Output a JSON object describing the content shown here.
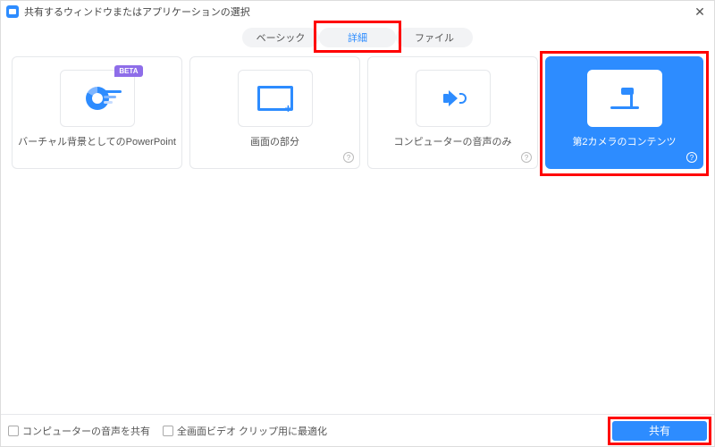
{
  "window": {
    "title": "共有するウィンドウまたはアプリケーションの選択"
  },
  "tabs": {
    "basic": "ベーシック",
    "advanced": "詳細",
    "file": "ファイル"
  },
  "cards": {
    "ppt": {
      "label": "バーチャル背景としてのPowerPoint",
      "badge": "BETA"
    },
    "portion": {
      "label": "画面の部分"
    },
    "audio": {
      "label": "コンピューターの音声のみ"
    },
    "camera2": {
      "label": "第2カメラのコンテンツ"
    }
  },
  "footer": {
    "share_audio": "コンピューターの音声を共有",
    "optimize_video": "全画面ビデオ クリップ用に最適化",
    "share_button": "共有"
  },
  "info_glyph": "?"
}
